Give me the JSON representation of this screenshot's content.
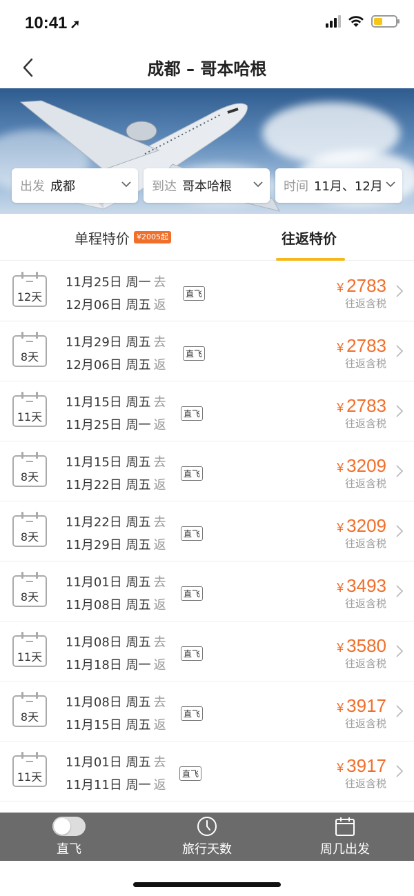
{
  "status_bar": {
    "time": "10:41",
    "battery_level": 0.4
  },
  "nav": {
    "title": "成都 – 哥本哈根"
  },
  "filters": [
    {
      "label": "出发",
      "value": "成都"
    },
    {
      "label": "到达",
      "value": "哥本哈根"
    },
    {
      "label": "时间",
      "value": "11月、12月"
    }
  ],
  "tabs": {
    "oneway": {
      "label": "单程特价",
      "badge": "¥2005起"
    },
    "round": {
      "label": "往返特价",
      "active": true
    }
  },
  "direct_label": "直飞",
  "depart_word": "去",
  "return_word": "返",
  "tax_label": "往返含税",
  "currency": "¥",
  "deals": [
    {
      "days": "12天",
      "out": "11月25日 周一",
      "back": "12月06日 周五",
      "price": "2783"
    },
    {
      "days": "8天",
      "out": "11月29日 周五",
      "back": "12月06日 周五",
      "price": "2783"
    },
    {
      "days": "11天",
      "out": "11月15日 周五",
      "back": "11月25日 周一",
      "price": "2783"
    },
    {
      "days": "8天",
      "out": "11月15日 周五",
      "back": "11月22日 周五",
      "price": "3209"
    },
    {
      "days": "8天",
      "out": "11月22日 周五",
      "back": "11月29日 周五",
      "price": "3209"
    },
    {
      "days": "8天",
      "out": "11月01日 周五",
      "back": "11月08日 周五",
      "price": "3493"
    },
    {
      "days": "11天",
      "out": "11月08日 周五",
      "back": "11月18日 周一",
      "price": "3580"
    },
    {
      "days": "8天",
      "out": "11月08日 周五",
      "back": "11月15日 周五",
      "price": "3917"
    },
    {
      "days": "11天",
      "out": "11月01日 周五",
      "back": "11月11日 周一",
      "price": "3917"
    }
  ],
  "bottom_bar": [
    {
      "label": "直飞",
      "icon": "toggle-switch"
    },
    {
      "label": "旅行天数",
      "icon": "clock-icon"
    },
    {
      "label": "周几出发",
      "icon": "calendar-icon"
    }
  ],
  "colors": {
    "accent": "#f5b818",
    "price": "#f06f2b",
    "bottom_bar": "#6b6b6b"
  }
}
